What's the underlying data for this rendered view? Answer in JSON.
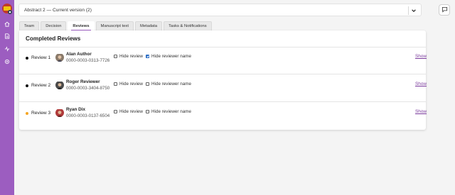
{
  "header": {
    "version_title": "Abstract 2",
    "version_label": " — Current version (2)",
    "caret_icon": "chevron-down-icon",
    "chat_icon": "chat-icon"
  },
  "nav_rail": {
    "items": [
      "home-icon",
      "document-icon",
      "activity-icon",
      "settings-icon"
    ]
  },
  "tabs": [
    {
      "label": "Team",
      "active": false
    },
    {
      "label": "Decision",
      "active": false
    },
    {
      "label": "Reviews",
      "active": true
    },
    {
      "label": "Manuscript text",
      "active": false
    },
    {
      "label": "Metadata",
      "active": false
    },
    {
      "label": "Tasks & Notifications",
      "active": false
    }
  ],
  "panel": {
    "title": "Completed Reviews",
    "hide_review_label": "Hide review",
    "hide_name_label": "Hide reviewer name",
    "show_label": "Show",
    "reviews": [
      {
        "label": "Review 1",
        "status_color": "#111111",
        "name": "Alan Author",
        "orcid": "0000-0003-0313-7726",
        "hide_review": false,
        "hide_name": true
      },
      {
        "label": "Review 2",
        "status_color": "#111111",
        "name": "Roger Reviewer",
        "orcid": "0000-0003-3404-8750",
        "hide_review": false,
        "hide_name": false
      },
      {
        "label": "Review 3",
        "status_color": "#f5a623",
        "name": "Ryan Dix",
        "orcid": "0000-0003-0137-6504",
        "hide_review": false,
        "hide_name": false
      }
    ]
  },
  "colors": {
    "rail": "#9c5dc0",
    "accent": "#9c5dc0",
    "link": "#7a3a9c",
    "checkbox_checked": "#2a6cc4"
  }
}
